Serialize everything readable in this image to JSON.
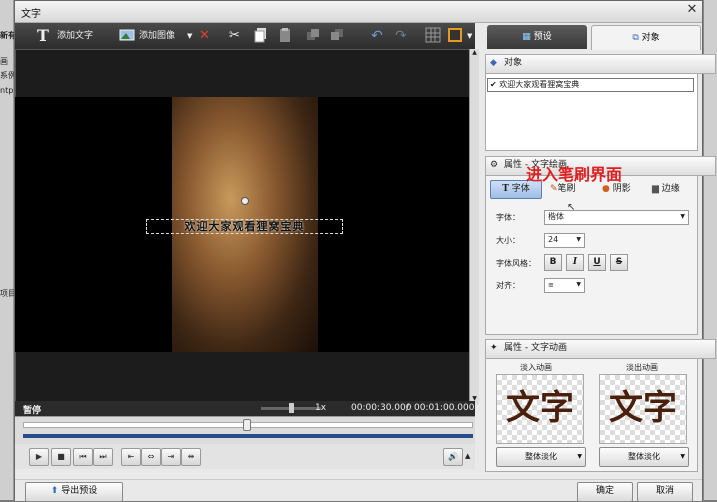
{
  "window": {
    "title": "文字"
  },
  "bg_app": {
    "left_labels": [
      "新有",
      "画",
      "系例",
      "ntp",
      "项目"
    ]
  },
  "toolbar": {
    "add_text": "添加文字",
    "add_image": "添加图像"
  },
  "tabs": [
    {
      "label": "预设"
    },
    {
      "label": "对象"
    }
  ],
  "objects_panel": {
    "title": "对象",
    "items": [
      {
        "label": "欢迎大家观看狸窝宝典",
        "checked": true
      }
    ]
  },
  "props_panel": {
    "title": "属性 - 文字绘画",
    "annotation": "进入笔刷界面",
    "subtabs": [
      {
        "label": "字体"
      },
      {
        "label": "笔刷"
      },
      {
        "label": "阴影"
      },
      {
        "label": "边缘"
      }
    ],
    "font_label": "字体：",
    "font_value": "楷体",
    "size_label": "大小：",
    "size_value": "24",
    "style_label": "字体风格：",
    "style_buttons": [
      "B",
      "I",
      "U",
      "S"
    ],
    "align_label": "对齐："
  },
  "anim_panel": {
    "title": "属性 - 文字动画",
    "in_label": "淡入动画",
    "out_label": "淡出动画",
    "preview_text": "文字",
    "in_select": "整体淡化",
    "out_select": "整体淡化"
  },
  "preview": {
    "overlay_text": "欢迎大家观看狸窝宝典"
  },
  "playback": {
    "status": "暂停",
    "speed": "1x",
    "current_time": "00:00:30.000",
    "separator": "/",
    "total_time": "00:01:00.000",
    "slider_fraction": 0.5
  },
  "footer": {
    "export_preset": "导出预设",
    "ok": "确定",
    "cancel": "取消"
  }
}
